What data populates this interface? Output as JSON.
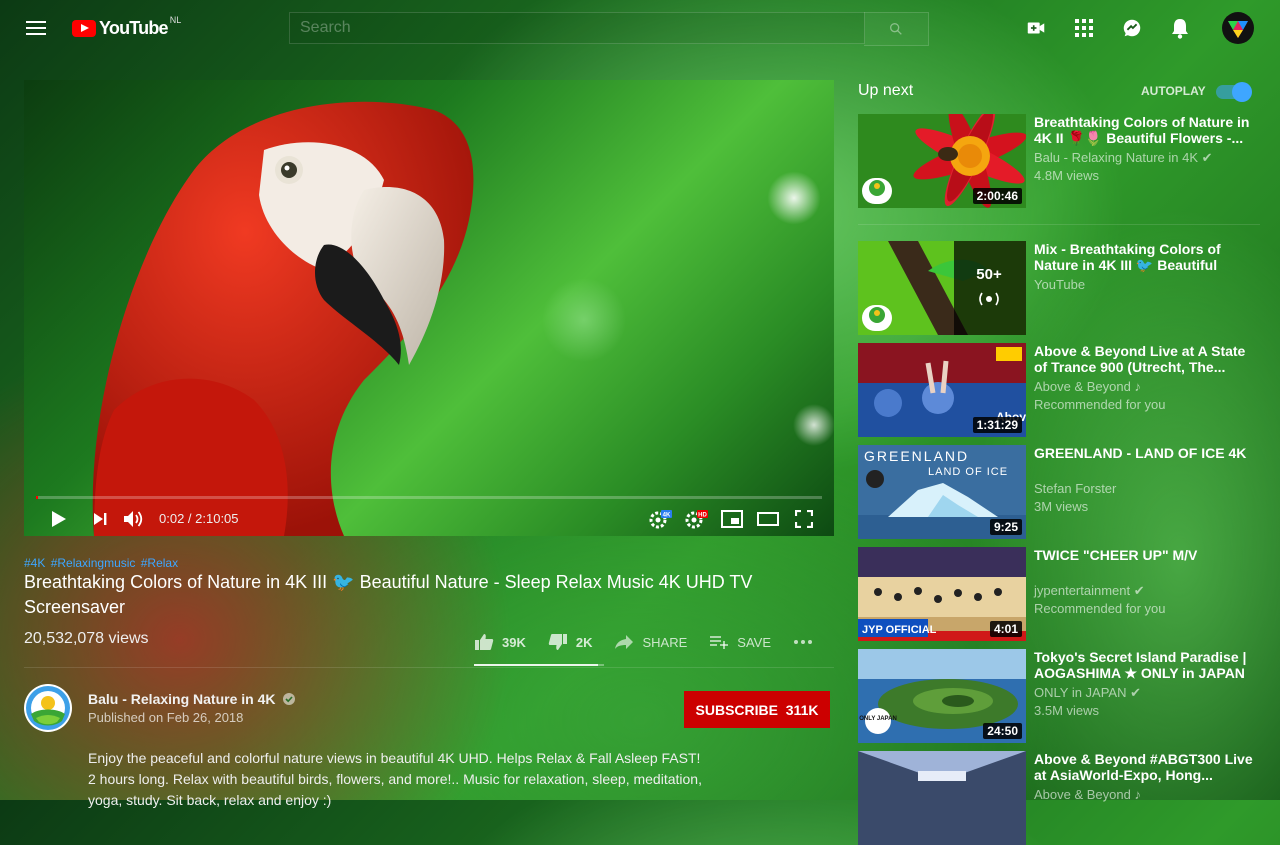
{
  "masthead": {
    "logo_text": "YouTube",
    "region": "NL",
    "search_placeholder": "Search",
    "icons": [
      "menu-icon",
      "create-video-icon",
      "apps-icon",
      "messages-icon",
      "notifications-icon",
      "account-avatar"
    ]
  },
  "player": {
    "current_time": "0:02",
    "duration": "2:10:05",
    "time_display": "0:02 / 2:10:05",
    "progress": 0.0003,
    "settings_badge": "4K",
    "subtitle_badge": "HD",
    "icons": [
      "play-icon",
      "next-icon",
      "volume-icon",
      "autoplay-settings-icon",
      "settings-icon",
      "miniplayer-icon",
      "theater-icon",
      "fullscreen-icon"
    ]
  },
  "video": {
    "hashtags": [
      "#4K",
      "#Relaxingmusic",
      "#Relax"
    ],
    "title": "Breathtaking Colors of Nature in 4K III 🐦 Beautiful Nature - Sleep Relax Music 4K UHD TV Screensaver",
    "views": "20,532,078 views",
    "likes": "39K",
    "dislikes": "2K",
    "share_label": "SHARE",
    "save_label": "SAVE",
    "like_ratio": 0.95
  },
  "channel": {
    "name": "Balu - Relaxing Nature in 4K",
    "published": "Published on Feb 26, 2018",
    "subscribe_label": "SUBSCRIBE",
    "subscriber_count": "311K",
    "verified": true
  },
  "description": {
    "lines": [
      "Enjoy the peaceful and colorful nature views in beautiful 4K UHD.  Helps Relax & Fall Asleep FAST!",
      "2 hours long. Relax with beautiful birds, flowers, and more!..  Music for relaxation, sleep, meditation,",
      "yoga, study. Sit back, relax and enjoy :)"
    ]
  },
  "sidebar": {
    "up_next_label": "Up next",
    "autoplay_label": "AUTOPLAY",
    "autoplay_on": true,
    "items": [
      {
        "title": "Breathtaking Colors of Nature in 4K II 🌹🌷 Beautiful Flowers -...",
        "channel": "Balu - Relaxing Nature in 4K",
        "verified": true,
        "meta": "4.8M views",
        "duration": "2:00:46",
        "thumb_icon": "flower-bee-thumbnail"
      },
      {
        "title": "Mix - Breathtaking Colors of Nature in 4K III 🐦 Beautiful Nature - Slee...",
        "channel": "YouTube",
        "verified": false,
        "meta": "",
        "duration": "",
        "playlist_count": "50+",
        "thumb_icon": "toucan-thumbnail"
      },
      {
        "title": "Above & Beyond Live at A State of Trance 900 (Utrecht, The...",
        "channel": "Above & Beyond",
        "verified": false,
        "music": true,
        "meta": "Recommended for you",
        "duration": "1:31:29",
        "thumb_icon": "concert-thumbnail",
        "thumb_text": "Above"
      },
      {
        "title": "GREENLAND - LAND OF ICE 4K",
        "channel": "Stefan Forster",
        "verified": false,
        "meta": "3M views",
        "duration": "9:25",
        "thumb_icon": "iceberg-thumbnail",
        "thumb_text_1": "GREENLAND",
        "thumb_text_2": "LAND OF ICE"
      },
      {
        "title": "TWICE \"CHEER UP\" M/V",
        "channel": "jypentertainment",
        "verified": true,
        "meta": "Recommended for you",
        "duration": "4:01",
        "thumb_icon": "dancers-thumbnail",
        "thumb_text": "JYP OFFICIAL"
      },
      {
        "title": "Tokyo's Secret Island Paradise | AOGASHIMA ★ ONLY in JAPAN",
        "channel": "ONLY in JAPAN",
        "verified": true,
        "meta": "3.5M views",
        "duration": "24:50",
        "thumb_icon": "island-thumbnail",
        "thumb_text": "ONLY JAPAN"
      },
      {
        "title": "Above & Beyond #ABGT300 Live at AsiaWorld-Expo, Hong...",
        "channel": "Above & Beyond",
        "verified": false,
        "music": true,
        "meta": "",
        "duration": "",
        "thumb_icon": "stage-thumbnail"
      }
    ]
  },
  "colors": {
    "accent": "#3ea6ff",
    "subscribe": "#cc0000",
    "brand_red": "#ff0000"
  }
}
